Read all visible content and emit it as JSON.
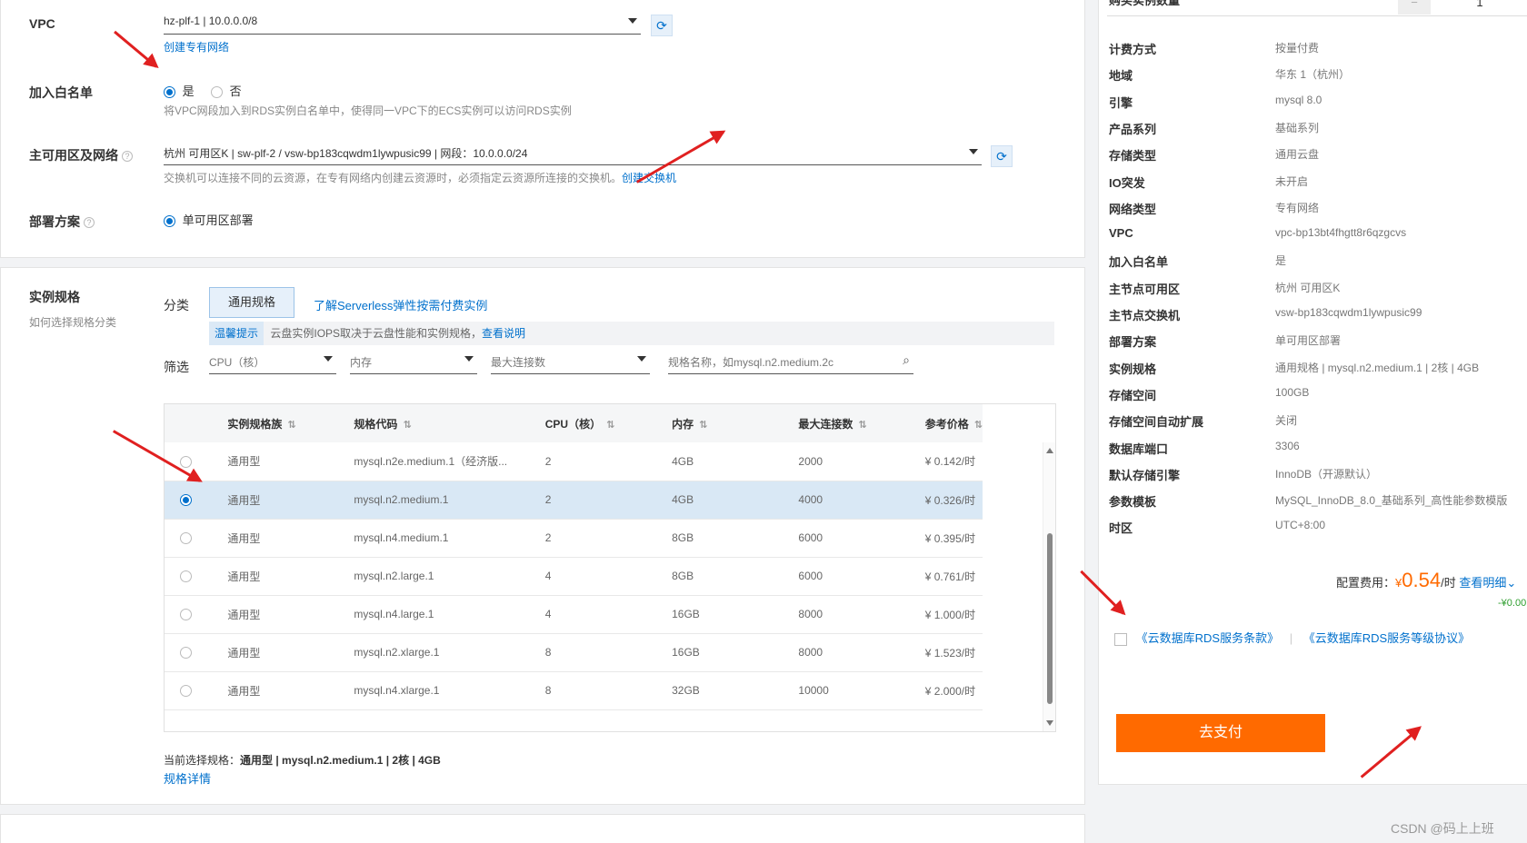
{
  "vpc": {
    "label": "VPC",
    "value": "hz-plf-1 | 10.0.0.0/8",
    "create_link": "创建专有网络"
  },
  "whitelist": {
    "label": "加入白名单",
    "yes": "是",
    "no": "否",
    "hint": "将VPC网段加入到RDS实例白名单中，使得同一VPC下的ECS实例可以访问RDS实例"
  },
  "zone": {
    "label": "主可用区及网络",
    "value": "杭州 可用区K | sw-plf-2 / vsw-bp183cqwdm1lywpusic99 | 网段：10.0.0.0/24",
    "hint": "交换机可以连接不同的云资源，在专有网络内创建云资源时，必须指定云资源所连接的交换机。",
    "create_link": "创建交换机"
  },
  "deploy": {
    "label": "部署方案",
    "option": "单可用区部署"
  },
  "spec": {
    "label": "实例规格",
    "sub": "如何选择规格分类",
    "category_label": "分类",
    "category_tab": "通用规格",
    "serverless_link": "了解Serverless弹性按需付费实例",
    "tip_tag": "温馨提示",
    "tip_text": "云盘实例IOPS取决于云盘性能和实例规格，",
    "tip_link": "查看说明",
    "filter_label": "筛选",
    "filter_cpu": "CPU（核）",
    "filter_mem": "内存",
    "filter_conn": "最大连接数",
    "search_placeholder": "规格名称，如mysql.n2.medium.2c",
    "columns": [
      "实例规格族",
      "规格代码",
      "CPU（核）",
      "内存",
      "最大连接数",
      "参考价格"
    ],
    "rows": [
      {
        "family": "通用型",
        "code": "mysql.n2e.medium.1（经济版...",
        "cpu": "2",
        "mem": "4GB",
        "conn": "2000",
        "price": "¥ 0.142/时",
        "selected": false
      },
      {
        "family": "通用型",
        "code": "mysql.n2.medium.1",
        "cpu": "2",
        "mem": "4GB",
        "conn": "4000",
        "price": "¥ 0.326/时",
        "selected": true
      },
      {
        "family": "通用型",
        "code": "mysql.n4.medium.1",
        "cpu": "2",
        "mem": "8GB",
        "conn": "6000",
        "price": "¥ 0.395/时",
        "selected": false
      },
      {
        "family": "通用型",
        "code": "mysql.n2.large.1",
        "cpu": "4",
        "mem": "8GB",
        "conn": "6000",
        "price": "¥ 0.761/时",
        "selected": false
      },
      {
        "family": "通用型",
        "code": "mysql.n4.large.1",
        "cpu": "4",
        "mem": "16GB",
        "conn": "8000",
        "price": "¥ 1.000/时",
        "selected": false
      },
      {
        "family": "通用型",
        "code": "mysql.n2.xlarge.1",
        "cpu": "8",
        "mem": "16GB",
        "conn": "8000",
        "price": "¥ 1.523/时",
        "selected": false
      },
      {
        "family": "通用型",
        "code": "mysql.n4.xlarge.1",
        "cpu": "8",
        "mem": "32GB",
        "conn": "10000",
        "price": "¥ 2.000/时",
        "selected": false
      }
    ],
    "current_prefix": "当前选择规格：",
    "current_value": "通用型 | mysql.n2.medium.1 | 2核 | 4GB",
    "detail_link": "规格详情"
  },
  "summary": {
    "header": "购买实例数量",
    "qty": "1",
    "items": [
      {
        "k": "计费方式",
        "v": "按量付费"
      },
      {
        "k": "地域",
        "v": "华东 1（杭州）"
      },
      {
        "k": "引擎",
        "v": "mysql 8.0"
      },
      {
        "k": "产品系列",
        "v": "基础系列"
      },
      {
        "k": "存储类型",
        "v": "通用云盘"
      },
      {
        "k": "IO突发",
        "v": "未开启"
      },
      {
        "k": "网络类型",
        "v": "专有网络"
      },
      {
        "k": "VPC",
        "v": "vpc-bp13bt4fhgtt8r6qzgcvs"
      },
      {
        "k": "加入白名单",
        "v": "是"
      },
      {
        "k": "主节点可用区",
        "v": "杭州 可用区K"
      },
      {
        "k": "主节点交换机",
        "v": "vsw-bp183cqwdm1lywpusic99"
      },
      {
        "k": "部署方案",
        "v": "单可用区部署"
      },
      {
        "k": "实例规格",
        "v": "通用规格 | mysql.n2.medium.1 | 2核 | 4GB"
      },
      {
        "k": "存储空间",
        "v": "100GB"
      },
      {
        "k": "存储空间自动扩展",
        "v": "关闭"
      },
      {
        "k": "数据库端口",
        "v": "3306"
      },
      {
        "k": "默认存储引擎",
        "v": "InnoDB（开源默认）"
      },
      {
        "k": "参数模板",
        "v": "MySQL_InnoDB_8.0_基础系列_高性能参数模版"
      },
      {
        "k": "时区",
        "v": "UTC+8:00"
      }
    ],
    "fee_label": "配置费用：",
    "fee_currency": "¥",
    "fee_value": "0.54",
    "fee_unit": "/时",
    "fee_detail": "查看明细",
    "discount": "-¥0.00",
    "agreement1": "《云数据库RDS服务条款》",
    "agreement_sep": "|",
    "agreement2": "《云数据库RDS服务等级协议》",
    "pay_button": "去支付"
  },
  "watermark": "CSDN @码上上班"
}
